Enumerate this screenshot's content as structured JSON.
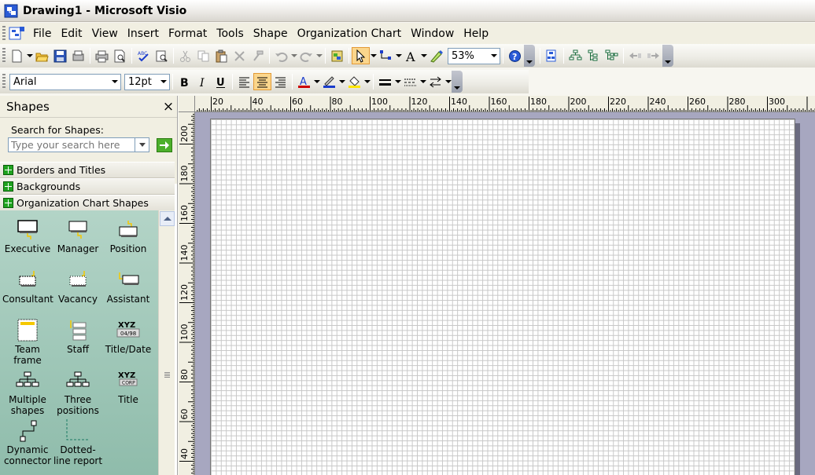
{
  "window": {
    "title": "Drawing1 - Microsoft Visio"
  },
  "menubar": {
    "items": [
      "File",
      "Edit",
      "View",
      "Insert",
      "Format",
      "Tools",
      "Shape",
      "Organization Chart",
      "Window",
      "Help"
    ]
  },
  "standard_toolbar": {
    "zoom": "53%"
  },
  "formatting_toolbar": {
    "font": "Arial",
    "size": "12pt",
    "font_color": "#cc0000",
    "line_color": "#1a3ccc",
    "fill_color": "#ffe600"
  },
  "shapes_pane": {
    "title": "Shapes",
    "close": "×",
    "search_label": "Search for Shapes:",
    "search_placeholder": "Type your search here",
    "stencils": [
      "Borders and Titles",
      "Backgrounds",
      "Organization Chart Shapes"
    ],
    "masters": [
      {
        "label": "Executive",
        "icon": "executive-shape-icon"
      },
      {
        "label": "Manager",
        "icon": "manager-shape-icon"
      },
      {
        "label": "Position",
        "icon": "position-shape-icon"
      },
      {
        "label": "Consultant",
        "icon": "consultant-shape-icon"
      },
      {
        "label": "Vacancy",
        "icon": "vacancy-shape-icon"
      },
      {
        "label": "Assistant",
        "icon": "assistant-shape-icon"
      },
      {
        "label": "Team frame",
        "icon": "team-frame-shape-icon"
      },
      {
        "label": "Staff",
        "icon": "staff-shape-icon"
      },
      {
        "label": "Title/Date",
        "icon": "title-date-shape-icon"
      },
      {
        "label": "Multiple shapes",
        "icon": "multiple-shapes-icon"
      },
      {
        "label": "Three positions",
        "icon": "three-positions-icon"
      },
      {
        "label": "Title",
        "icon": "title-shape-icon"
      },
      {
        "label": "Dynamic connector",
        "icon": "dynamic-connector-icon"
      },
      {
        "label": "Dotted-line report",
        "icon": "dotted-line-report-icon"
      }
    ]
  },
  "rulers": {
    "horizontal_labels": [
      "20",
      "40",
      "60",
      "80",
      "100",
      "120",
      "140",
      "160",
      "180",
      "200",
      "220",
      "240",
      "260",
      "280",
      "300"
    ],
    "vertical_labels": [
      "200",
      "180",
      "160",
      "140",
      "120",
      "100",
      "80",
      "60",
      "40"
    ]
  }
}
